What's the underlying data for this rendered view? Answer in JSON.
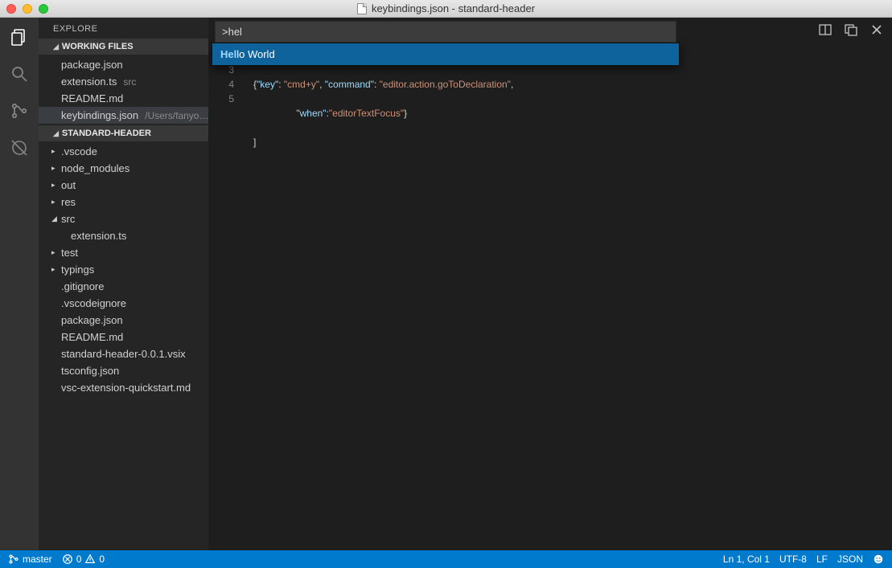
{
  "window": {
    "title": "keybindings.json - standard-header"
  },
  "sidebar": {
    "title": "EXPLORE",
    "working_files_header": "WORKING FILES",
    "working_files": [
      {
        "name": "package.json",
        "desc": ""
      },
      {
        "name": "extension.ts",
        "desc": "src"
      },
      {
        "name": "README.md",
        "desc": ""
      },
      {
        "name": "keybindings.json",
        "desc": "/Users/fanyo…"
      }
    ],
    "project_header": "STANDARD-HEADER",
    "project_tree": [
      {
        "name": ".vscode",
        "type": "folder",
        "expanded": false
      },
      {
        "name": "node_modules",
        "type": "folder",
        "expanded": false
      },
      {
        "name": "out",
        "type": "folder",
        "expanded": false
      },
      {
        "name": "res",
        "type": "folder",
        "expanded": false
      },
      {
        "name": "src",
        "type": "folder",
        "expanded": true
      },
      {
        "name": "extension.ts",
        "type": "file",
        "indent": true
      },
      {
        "name": "test",
        "type": "folder",
        "expanded": false
      },
      {
        "name": "typings",
        "type": "folder",
        "expanded": false
      },
      {
        "name": ".gitignore",
        "type": "file"
      },
      {
        "name": ".vscodeignore",
        "type": "file"
      },
      {
        "name": "package.json",
        "type": "file"
      },
      {
        "name": "README.md",
        "type": "file"
      },
      {
        "name": "standard-header-0.0.1.vsix",
        "type": "file"
      },
      {
        "name": "tsconfig.json",
        "type": "file"
      },
      {
        "name": "vsc-extension-quickstart.md",
        "type": "file"
      }
    ]
  },
  "palette": {
    "value": ">hel",
    "suggestion_prefix": "Hel",
    "suggestion_rest": "lo World"
  },
  "code": {
    "line3": {
      "open": "{",
      "k1": "\"key\"",
      "c1": ": ",
      "v1": "\"cmd+y\"",
      "c2": ", ",
      "k2": "\"command\"",
      "c3": ": ",
      "v2": "\"editor.action.goToDeclaration\"",
      "end": ","
    },
    "line4": {
      "k1": "\"when\"",
      "c1": ":",
      "v1": "\"editorTextFocus\"",
      "end": "}"
    },
    "line5": "]",
    "gutter": [
      "3",
      "4",
      "5"
    ]
  },
  "statusbar": {
    "branch": "master",
    "errors": "0",
    "warnings": "0",
    "position": "Ln 1, Col 1",
    "encoding": "UTF-8",
    "eol": "LF",
    "language": "JSON"
  }
}
